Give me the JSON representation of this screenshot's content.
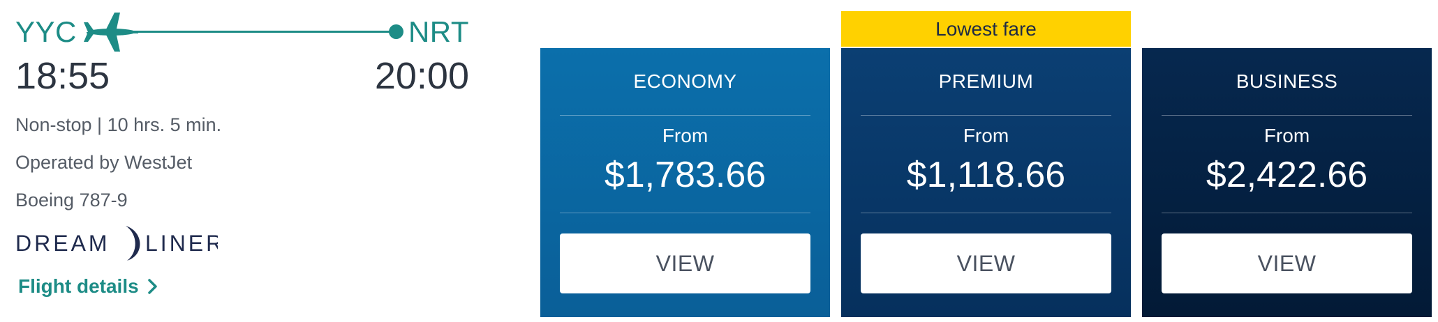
{
  "flight": {
    "origin": "YYC",
    "destination": "NRT",
    "departure_time": "18:55",
    "arrival_time": "20:00",
    "duration_line": "Non-stop | 10 hrs. 5 min.",
    "operator_line": "Operated by WestJet",
    "aircraft": "Boeing 787-9",
    "aircraft_logo_text": "DREAMLINER",
    "details_link": "Flight details"
  },
  "fares": {
    "lowest_label": "Lowest fare",
    "economy": {
      "title": "ECONOMY",
      "from": "From",
      "price": "$1,783.66",
      "button": "VIEW"
    },
    "premium": {
      "title": "PREMIUM",
      "from": "From",
      "price": "$1,118.66",
      "button": "VIEW"
    },
    "business": {
      "title": "BUSINESS",
      "from": "From",
      "price": "$2,422.66",
      "button": "VIEW"
    }
  },
  "colors": {
    "accent": "#1d8c86",
    "economy": "#0b6fab",
    "premium": "#0b3f73",
    "business": "#06284f",
    "banner": "#ffd100"
  },
  "icons": [
    "airplane-icon",
    "destination-dot-icon",
    "chevron-right-icon"
  ]
}
